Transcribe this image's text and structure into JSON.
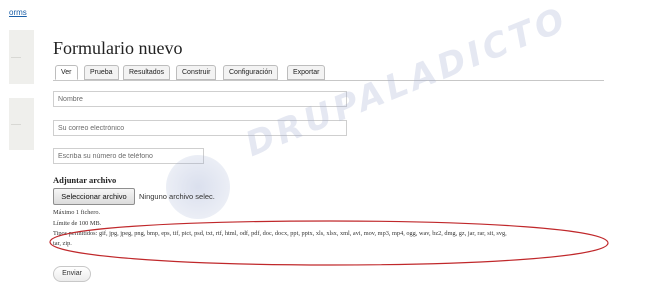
{
  "breadcrumb": "orms",
  "page": {
    "title": "Formulario nuevo"
  },
  "tabs": [
    {
      "label": "Ver",
      "active": true
    },
    {
      "label": "Prueba"
    },
    {
      "label": "Resultados"
    },
    {
      "label": "Construir"
    },
    {
      "label": "Configuración"
    },
    {
      "label": "Exportar"
    }
  ],
  "form": {
    "name_placeholder": "Nombre",
    "email_placeholder": "Su correo electrónico",
    "phone_placeholder": "Escriba su número de teléfono",
    "file": {
      "label": "Adjuntar archivo",
      "button_label": "Seleccionar archivo",
      "status": "Ninguno archivo selec.",
      "help_max_files": "Máximo 1 fichero.",
      "help_size_limit": "Límite de 100 MB.",
      "help_types_line1": "Tipos permitidos: gif, jpg, jpeg, png, bmp, eps, tif, pict, psd, txt, rtf, html, odf, pdf, doc, docx, ppt, pptx, xls, xlsx, xml, avi, mov, mp3, mp4, ogg, wav, bz2, dmg, gz, jar, rar, sit, svg,",
      "help_types_line2": "tar, zip."
    },
    "submit_label": "Enviar"
  },
  "watermark": {
    "text": "DRUPALADICTO"
  },
  "colors": {
    "link": "#1a5fa8",
    "annotation": "#c0282b"
  }
}
